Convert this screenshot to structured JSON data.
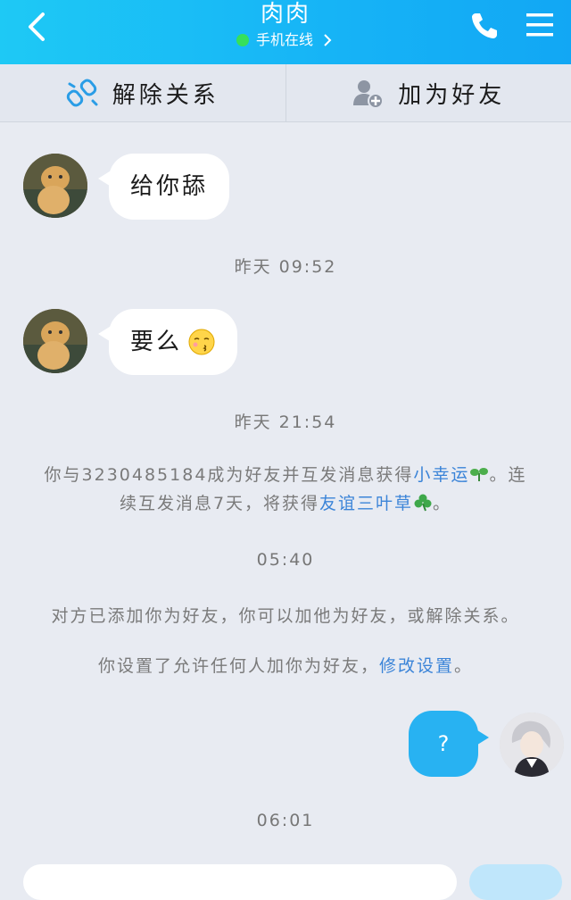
{
  "header": {
    "title": "肉肉",
    "status": "手机在线",
    "colors": {
      "bg": "#16b3f6",
      "online": "#36e05a"
    }
  },
  "actions": [
    {
      "label": "解除关系",
      "icon": "unlink-icon"
    },
    {
      "label": "加为好友",
      "icon": "add-friend-icon"
    }
  ],
  "messages": [
    {
      "text": "给你舔"
    },
    {
      "text": "要么"
    }
  ],
  "times": [
    "昨天 09:52",
    "昨天 21:54",
    "05:40",
    "06:01"
  ],
  "system": {
    "streak_pre": "你与3230485184成为好友并互发消息获得",
    "streak_link1": "小幸运",
    "streak_mid": "。连续互发消息7天，将获得",
    "streak_link2": "友谊三叶草",
    "streak_end": "。",
    "added_notice": "对方已添加你为好友，你可以加他为好友，或解除关系。",
    "settings_pre": "你设置了允许任何人加你为好友，",
    "settings_link": "修改设置",
    "settings_end": "。"
  },
  "my_message": "?"
}
